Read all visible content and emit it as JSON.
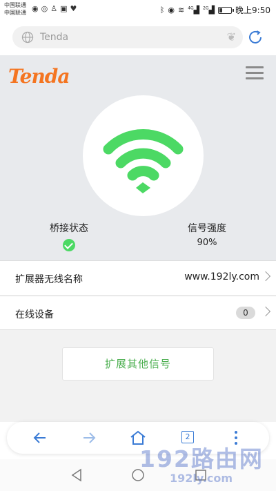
{
  "status_bar": {
    "carrier_1": "中国联通",
    "carrier_2": "中国联通",
    "network_1": "4G",
    "network_2": "2G",
    "time": "晚上9:50",
    "left_icons": [
      "weibo-icon",
      "wechat-icon",
      "qq-icon",
      "app-icon",
      "health-icon"
    ],
    "right_icons": [
      "bluetooth-icon",
      "eye-icon",
      "wifi-icon",
      "signal-icon",
      "signal-icon",
      "battery-icon"
    ]
  },
  "browser": {
    "url_text": "Tenda",
    "icons": [
      "globe-icon",
      "paw-icon",
      "reload-icon"
    ],
    "toolbar": {
      "tabs_count": "2",
      "icons": [
        "back-arrow-icon",
        "forward-arrow-icon",
        "home-icon",
        "tabs-icon",
        "more-icon"
      ]
    }
  },
  "page": {
    "logo": "Tenda",
    "menu_icon": "hamburger-menu-icon",
    "wifi_icon": "wifi-signal-icon",
    "bridge_status_label": "桥接状态",
    "bridge_status_icon": "check-circle-icon",
    "signal_strength_label": "信号强度",
    "signal_strength_value": "90%",
    "rows": [
      {
        "label": "扩展器无线名称",
        "value": "www.192ly.com"
      },
      {
        "label": "在线设备",
        "badge": "0"
      }
    ],
    "extend_button": "扩展其他信号"
  },
  "watermark": {
    "main": "192路由网",
    "sub": "192ly.com"
  },
  "colors": {
    "brand_orange": "#f47521",
    "wifi_green": "#4cd964",
    "button_green": "#4caf50",
    "link_blue": "#3a7bd5"
  }
}
